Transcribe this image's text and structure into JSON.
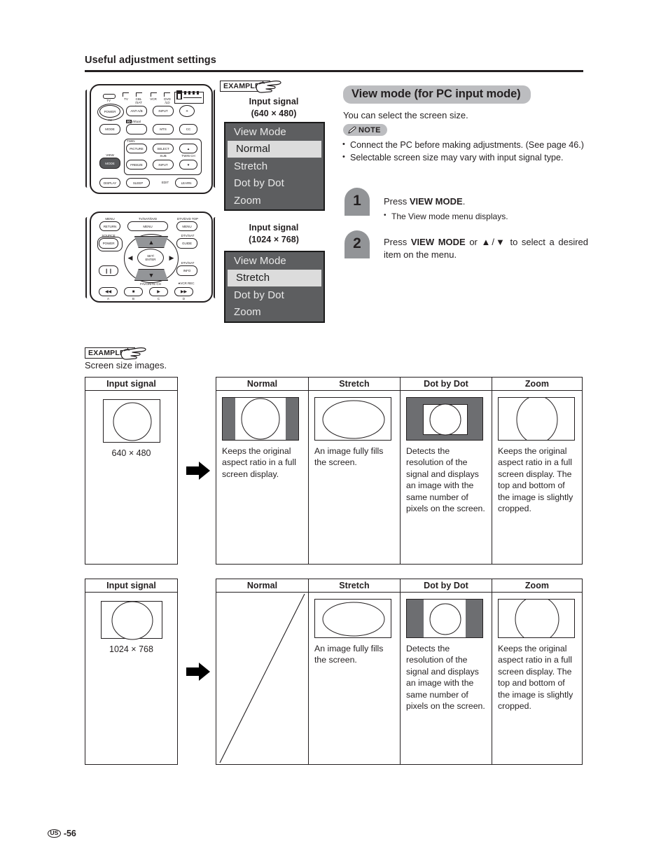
{
  "page": {
    "running_head": "Useful adjustment settings",
    "footer_region": "US",
    "footer_number": "-56"
  },
  "example_badge_top": {
    "label": "EXAMPLE",
    "icon": "pointing-hand-icon"
  },
  "example_badge_bottom": {
    "label": "EXAMPLE",
    "icon": "pointing-hand-icon",
    "caption": "Screen size images."
  },
  "remote_top": {
    "name": "remote-control-upper",
    "device_labels": [
      "TV",
      "CBL\n/SAT\n/DTV",
      "VCR",
      "DVD\n/LD"
    ],
    "buttons": [
      {
        "key": "power",
        "label": "POWER",
        "top_label": "TV",
        "bottom_label": "AV"
      },
      {
        "key": "alt-ab",
        "label": "ANT-A/B"
      },
      {
        "key": "input",
        "label": "INPUT"
      },
      {
        "key": "light",
        "label": "light-icon"
      },
      {
        "key": "mode",
        "label": "MODE"
      },
      {
        "key": "virtual",
        "label": "",
        "top_label": "3D Virtual"
      },
      {
        "key": "mts",
        "label": "MTS"
      },
      {
        "key": "cc",
        "label": "CC"
      },
      {
        "key": "picture",
        "label": "PICTURE",
        "group": "TWIN"
      },
      {
        "key": "select",
        "label": "SELECT"
      },
      {
        "key": "twin-ch-up",
        "label": "▲",
        "bottom_label": "TWIN CH"
      },
      {
        "key": "freeze",
        "label": "FREEZE"
      },
      {
        "key": "sub-input",
        "label": "INPUT",
        "top_label": "SUB"
      },
      {
        "key": "twin-ch-down",
        "label": "▼"
      },
      {
        "key": "view-mode",
        "label": "MODE",
        "top_label": "VIEW",
        "highlighted": true
      },
      {
        "key": "display",
        "label": "DISPLAY"
      },
      {
        "key": "sleep",
        "label": "SLEEP"
      },
      {
        "key": "learn",
        "label": "LEARN",
        "left_label": "EDIT"
      }
    ],
    "group_label": "TWIN"
  },
  "remote_bottom": {
    "name": "remote-control-lower",
    "buttons": [
      {
        "key": "return",
        "label": "RETURN",
        "top_label": "MENU"
      },
      {
        "key": "menu-main",
        "label": "MENU",
        "top_label": "TV/SAT/DVD"
      },
      {
        "key": "menu-dtv",
        "label": "MENU",
        "top_label": "DTV/DVD TOP"
      },
      {
        "key": "power",
        "label": "POWER",
        "top_label": "SOURCE"
      },
      {
        "key": "guide",
        "label": "GUIDE",
        "top_label": "DTV/SAT"
      },
      {
        "key": "info",
        "label": "INFO",
        "top_label": "DTV/SAT"
      },
      {
        "key": "pause",
        "label": "Ⅱ"
      },
      {
        "key": "up",
        "label": "▲"
      },
      {
        "key": "down",
        "label": "▼"
      },
      {
        "key": "left",
        "label": "◀"
      },
      {
        "key": "right",
        "label": "▶"
      },
      {
        "key": "set-enter",
        "label": "SET/\nENTER"
      },
      {
        "key": "rew",
        "label": "◀◀",
        "bottom_label": "A"
      },
      {
        "key": "stop",
        "label": "■",
        "bottom_label": "B"
      },
      {
        "key": "play",
        "label": "▶",
        "bottom_label": "C"
      },
      {
        "key": "ff",
        "label": "▶▶",
        "bottom_label": "D"
      }
    ],
    "favorite_label": "FAVORITE CH",
    "vcr_rec_label": "VCR REC"
  },
  "osd_menus": [
    {
      "signal_title": "Input signal",
      "signal_value": "(640 × 480)",
      "title": "View Mode",
      "items": [
        "Normal",
        "Stretch",
        "Dot by Dot",
        "Zoom"
      ],
      "selected": "Normal"
    },
    {
      "signal_title": "Input signal",
      "signal_value": "(1024 × 768)",
      "title": "View Mode",
      "items": [
        "Stretch",
        "Dot by Dot",
        "Zoom"
      ],
      "selected": "Stretch"
    }
  ],
  "section": {
    "title": "View mode (for PC input mode)",
    "subtitle": "You can select the screen size.",
    "note_label": "NOTE",
    "note_icon": "pencil-icon",
    "notes": [
      "Connect the PC before making adjustments. (See page 46.)",
      "Selectable screen size may vary with input signal type."
    ],
    "steps": [
      {
        "number": "1",
        "text_prefix": "Press ",
        "text_bold": "VIEW MODE",
        "text_suffix": ".",
        "subtext": "The View mode menu displays."
      },
      {
        "number": "2",
        "text_prefix": "Press ",
        "text_bold": "VIEW MODE",
        "text_suffix": " or ▲/▼ to select a desired item on the menu.",
        "subtext": ""
      }
    ]
  },
  "tables": [
    {
      "id": "table-640x480",
      "input_header": "Input signal",
      "input_caption": "640 × 480",
      "input_shape": "circle-portrait",
      "arrow": "right-arrow-icon",
      "columns": [
        {
          "header": "Normal",
          "caption": "Keeps the original aspect ratio in a full screen display.",
          "shape": "circle-with-side-bars"
        },
        {
          "header": "Stretch",
          "caption": "An image fully fills the screen.",
          "shape": "ellipse-full"
        },
        {
          "header": "Dot by Dot",
          "caption": "Detects the resolution of the signal and displays an image with the same number of pixels on the screen.",
          "shape": "circle-inset-letterbox"
        },
        {
          "header": "Zoom",
          "caption": "Keeps the original aspect ratio in a full screen display. The top and bottom of the image is slightly cropped.",
          "shape": "circle-cropped"
        }
      ]
    },
    {
      "id": "table-1024x768",
      "input_header": "Input signal",
      "input_caption": "1024 × 768",
      "input_shape": "circle-landscape",
      "arrow": "right-arrow-icon",
      "columns": [
        {
          "header": "Normal",
          "caption": "",
          "shape": "not-applicable-diagonal"
        },
        {
          "header": "Stretch",
          "caption": "An image fully fills the screen.",
          "shape": "ellipse-full"
        },
        {
          "header": "Dot by Dot",
          "caption": "Detects the resolution of the signal and displays an image with the same number of pixels on the screen.",
          "shape": "circle-with-side-bars"
        },
        {
          "header": "Zoom",
          "caption": "Keeps the original aspect ratio in a full screen display. The top and bottom of the image is slightly cropped.",
          "shape": "circle-cropped"
        }
      ]
    }
  ]
}
